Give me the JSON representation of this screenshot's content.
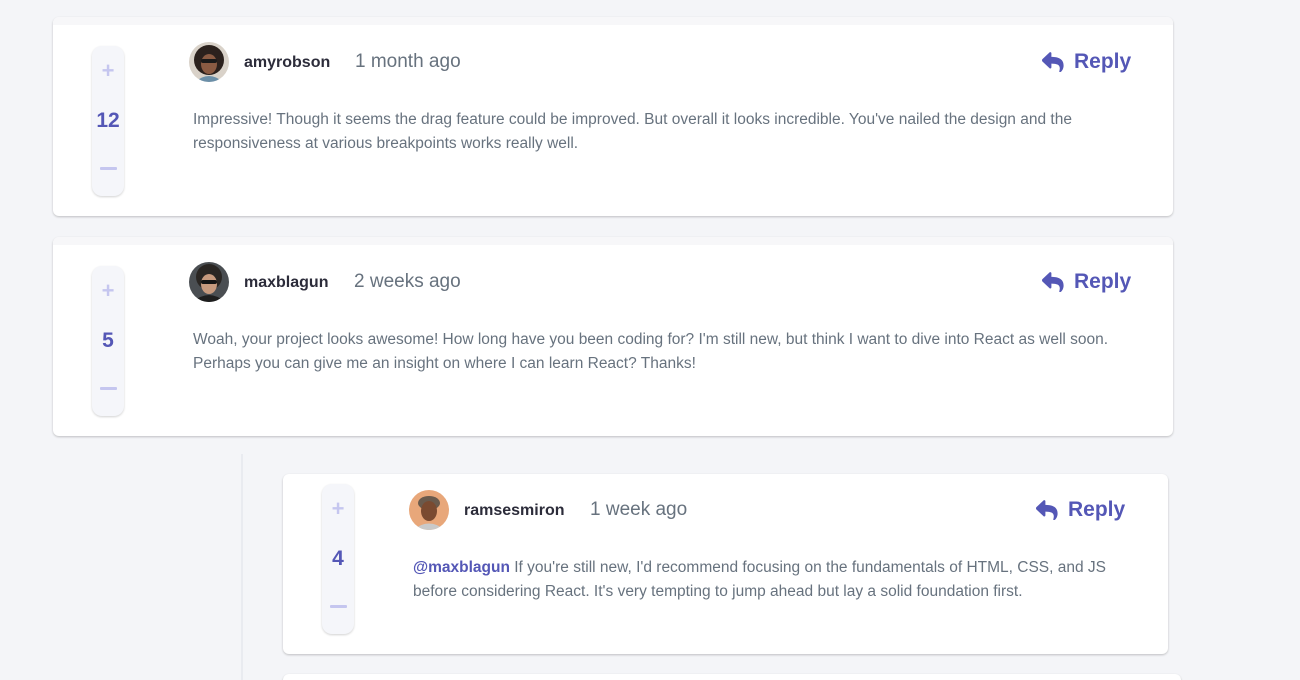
{
  "comments": [
    {
      "score": "12",
      "username": "amyrobson",
      "time": "1 month ago",
      "reply_label": "Reply",
      "content": "Impressive! Though it seems the drag feature could be improved. But overall it looks incredible. You've nailed the design and the responsiveness at various breakpoints works really well."
    },
    {
      "score": "5",
      "username": "maxblagun",
      "time": "2 weeks ago",
      "reply_label": "Reply",
      "content": "Woah, your project looks awesome! How long have you been coding for? I'm still new, but think I want to dive into React as well soon. Perhaps you can give me an insight on where I can learn React? Thanks!"
    }
  ],
  "replies": [
    {
      "score": "4",
      "username": "ramsesmiron",
      "time": "1 week ago",
      "reply_label": "Reply",
      "mention": "@maxblagun",
      "content": " If you're still new, I'd recommend focusing on the fundamentals of HTML, CSS, and JS before considering React. It's very tempting to jump ahead but lay a solid foundation first."
    }
  ],
  "icons": {
    "plus": "+",
    "reply": "reply-arrow-icon"
  },
  "colors": {
    "accent": "#5457b6",
    "accent_light": "#c5c6ef",
    "text": "#67727e",
    "username": "#2c2c3a",
    "background": "#f4f5f8"
  }
}
